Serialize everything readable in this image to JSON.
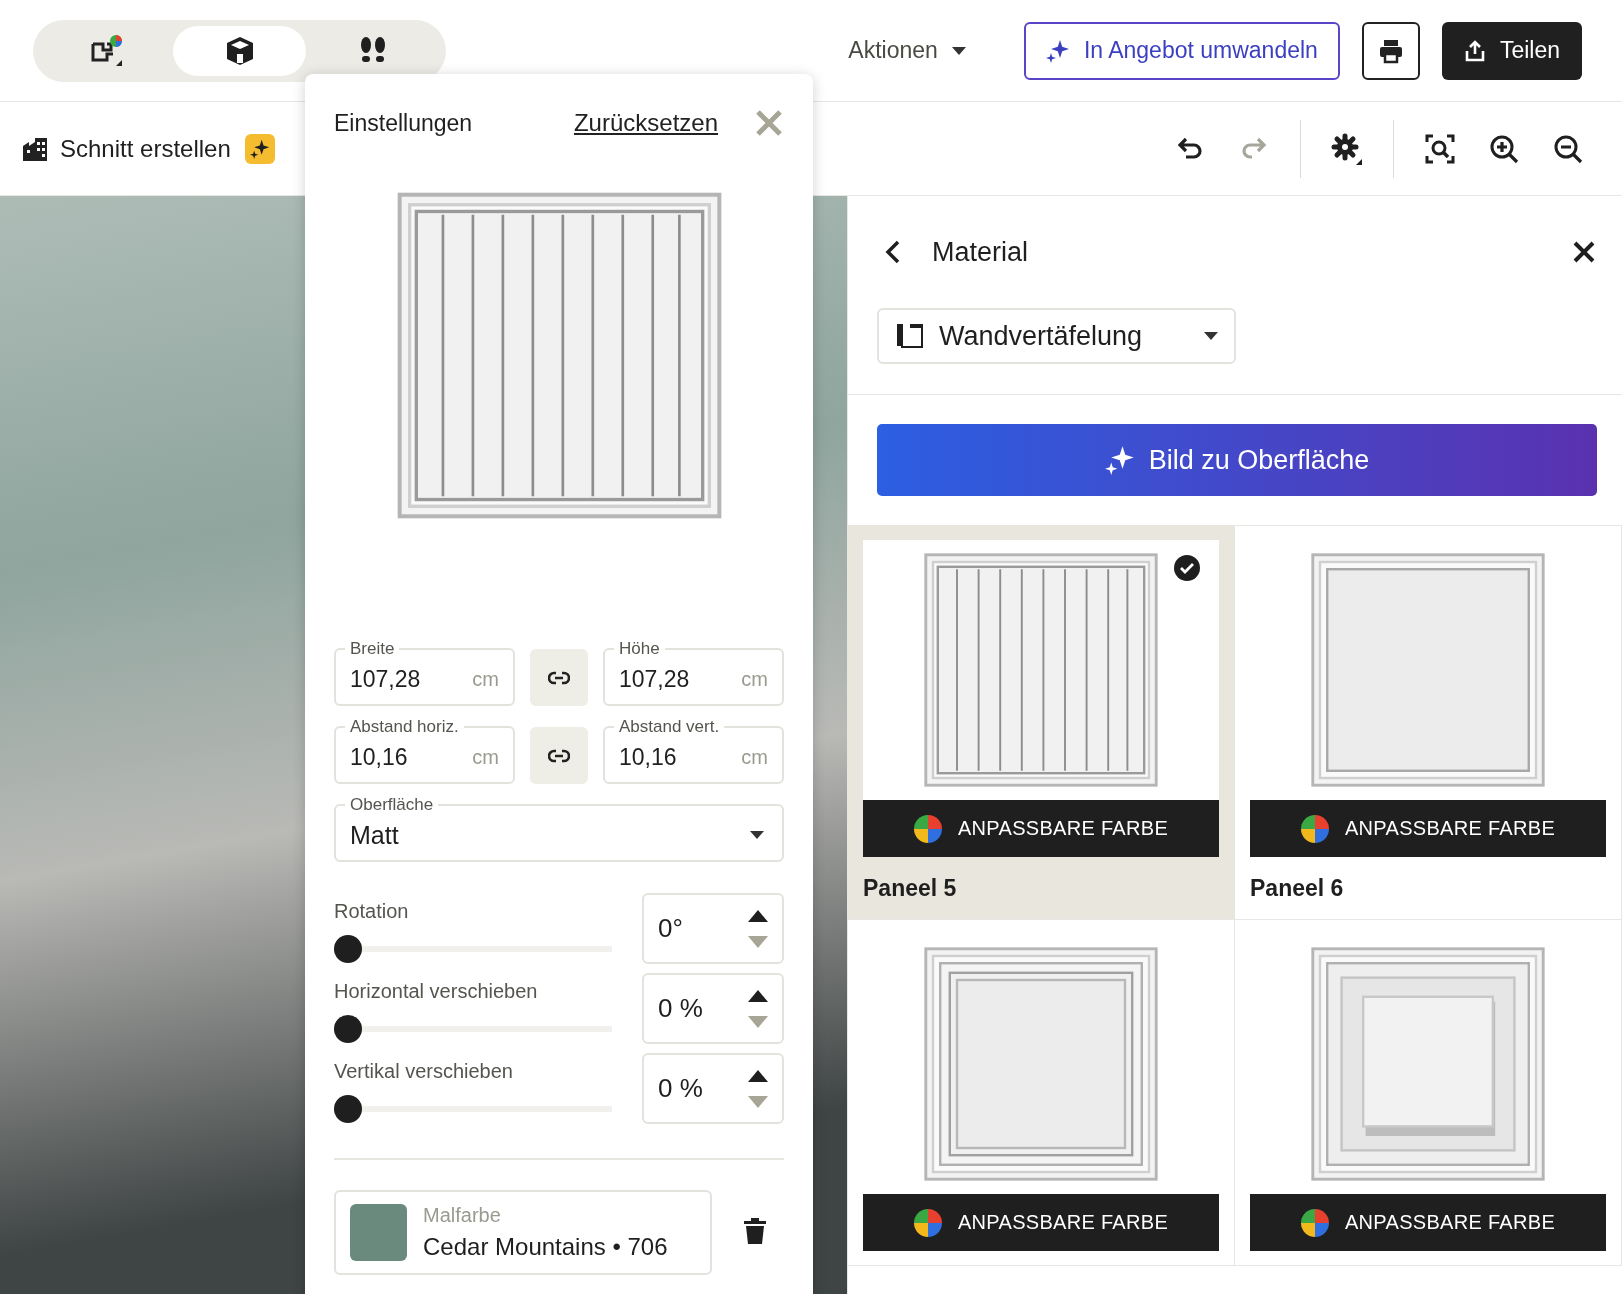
{
  "view_switcher": [
    {
      "kind": "floorplan",
      "selected": false
    },
    {
      "kind": "cube",
      "selected": true
    },
    {
      "kind": "walk",
      "selected": false
    }
  ],
  "actions_menu": {
    "label": "Aktionen"
  },
  "convert_button": {
    "label": "In Angebot umwandeln"
  },
  "share_button": {
    "label": "Teilen"
  },
  "section_button": {
    "label": "Schnitt erstellen"
  },
  "toolbar": [
    {
      "kind": "undo",
      "disabled": false
    },
    {
      "kind": "redo",
      "disabled": true
    },
    {
      "kind": "settings",
      "disabled": false
    },
    {
      "kind": "fit",
      "disabled": false
    },
    {
      "kind": "zoom-in",
      "disabled": false
    },
    {
      "kind": "zoom-out",
      "disabled": false
    }
  ],
  "settings_panel": {
    "title": "Einstellungen",
    "reset": "Zurücksetzen",
    "preview": {
      "kind": "grooved"
    },
    "dimension_rows": [
      [
        {
          "label": "Breite",
          "value": "107,28",
          "unit": "cm"
        },
        {
          "label": "Höhe",
          "value": "107,28",
          "unit": "cm"
        }
      ],
      [
        {
          "label": "Abstand horiz.",
          "value": "10,16",
          "unit": "cm"
        },
        {
          "label": "Abstand vert.",
          "value": "10,16",
          "unit": "cm"
        }
      ]
    ],
    "surface": {
      "label": "Oberfläche",
      "value": "Matt"
    },
    "adjustments": [
      {
        "label": "Rotation",
        "level": 0,
        "value": "0°",
        "decrement_disabled": true
      },
      {
        "label": "Horizontal verschieben",
        "level": 0,
        "value": "0 %",
        "decrement_disabled": true
      },
      {
        "label": "Vertikal verschieben",
        "level": 0,
        "value": "0 %",
        "decrement_disabled": true
      }
    ],
    "paint": {
      "label": "Malfarbe",
      "value": "Cedar Mountains • 706",
      "color": "#6b8a7e"
    }
  },
  "material_panel": {
    "title": "Material",
    "category": "Wandvertäfelung",
    "image_button": "Bild zu Oberfläche",
    "tiles": [
      {
        "kind": "grooved",
        "name": "Paneel 5",
        "badge": "ANPASSBARE FARBE",
        "selected": true
      },
      {
        "kind": "flat",
        "name": "Paneel 6",
        "badge": "ANPASSBARE FARBE",
        "selected": false
      },
      {
        "kind": "raised-frame",
        "badge": "ANPASSBARE FARBE",
        "selected": false
      },
      {
        "kind": "raised-center",
        "badge": "ANPASSBARE FARBE",
        "selected": false
      }
    ]
  }
}
